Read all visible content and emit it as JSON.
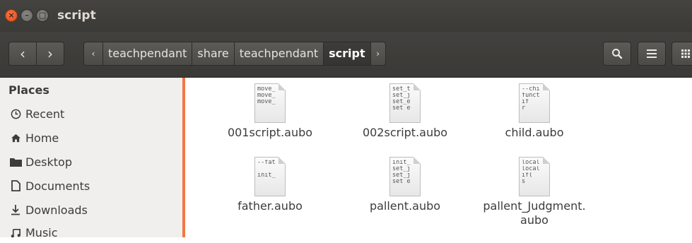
{
  "window": {
    "title": "script"
  },
  "toolbar": {
    "back_icon": "‹",
    "forward_icon": "›",
    "breadcrumbs": [
      {
        "label": "teachpendant"
      },
      {
        "label": "share"
      },
      {
        "label": "teachpendant"
      },
      {
        "label": "script"
      }
    ]
  },
  "sidebar": {
    "heading": "Places",
    "items": [
      {
        "label": "Recent",
        "icon": "clock-icon"
      },
      {
        "label": "Home",
        "icon": "home-icon"
      },
      {
        "label": "Desktop",
        "icon": "folder-icon"
      },
      {
        "label": "Documents",
        "icon": "document-icon"
      },
      {
        "label": "Downloads",
        "icon": "download-icon"
      },
      {
        "label": "Music",
        "icon": "music-icon"
      }
    ]
  },
  "files": [
    {
      "name": "001script.aubo",
      "preview": [
        "move_",
        "move_",
        "move_"
      ]
    },
    {
      "name": "002script.aubo",
      "preview": [
        "set_t",
        "set_j",
        "set_e",
        "set e"
      ]
    },
    {
      "name": "child.aubo",
      "preview": [
        "--chi",
        "funct",
        "  if",
        "   r"
      ]
    },
    {
      "name": "father.aubo",
      "preview": [
        "--fat",
        "",
        "init_"
      ]
    },
    {
      "name": "pallent.aubo",
      "preview": [
        "init_",
        "set_j",
        "set_j",
        "set e"
      ]
    },
    {
      "name": "pallent_Judgment.",
      "name2": "aubo",
      "preview": [
        "local",
        "local",
        "  if(",
        "   s"
      ]
    }
  ],
  "colors": {
    "accent": "#f07746",
    "titlebar": "#3c3b37",
    "sidebar": "#f0efed"
  }
}
